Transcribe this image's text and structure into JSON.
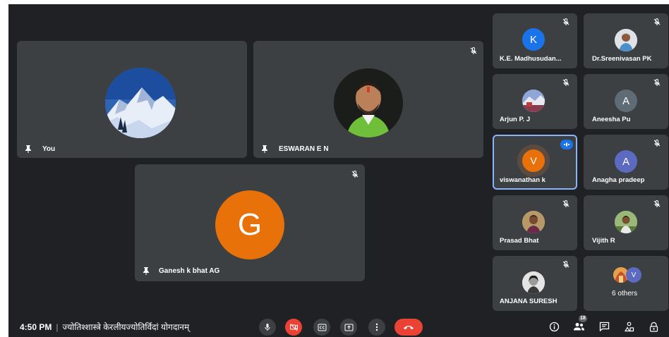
{
  "main_tiles": [
    {
      "name": "You"
    },
    {
      "name": "ESWARAN E N"
    },
    {
      "name": "Ganesh k bhat AG",
      "initial": "G"
    }
  ],
  "side_tiles": [
    {
      "name": "K.E. Madhusudan...",
      "initial": "K"
    },
    {
      "name": "Dr.Sreenivasan PK"
    },
    {
      "name": "Arjun P. J"
    },
    {
      "name": "Aneesha Pu",
      "initial": "A"
    },
    {
      "name": "viswanathan k",
      "initial": "V"
    },
    {
      "name": "Anagha pradeep",
      "initial": "A"
    },
    {
      "name": "Prasad Bhat"
    },
    {
      "name": "Vijith R"
    },
    {
      "name": "ANJANA SURESH"
    },
    {
      "name": "6 others",
      "initial": "V"
    }
  ],
  "footer": {
    "time": "4:50 PM",
    "separator": "|",
    "meeting_title": "ज्योतिश्शास्त्रे केरलीयज्योतिर्विदां योगदानम्"
  },
  "people_count": "18",
  "colors": {
    "background": "#202124",
    "tile": "#3c4043",
    "orange_avatar": "#e8710a",
    "blue_avatar": "#1a73e8",
    "slate_avatar": "#5f6368",
    "purple_avatar": "#5c6bc0",
    "red": "#ea4335",
    "active_border": "#8ab4f8"
  }
}
